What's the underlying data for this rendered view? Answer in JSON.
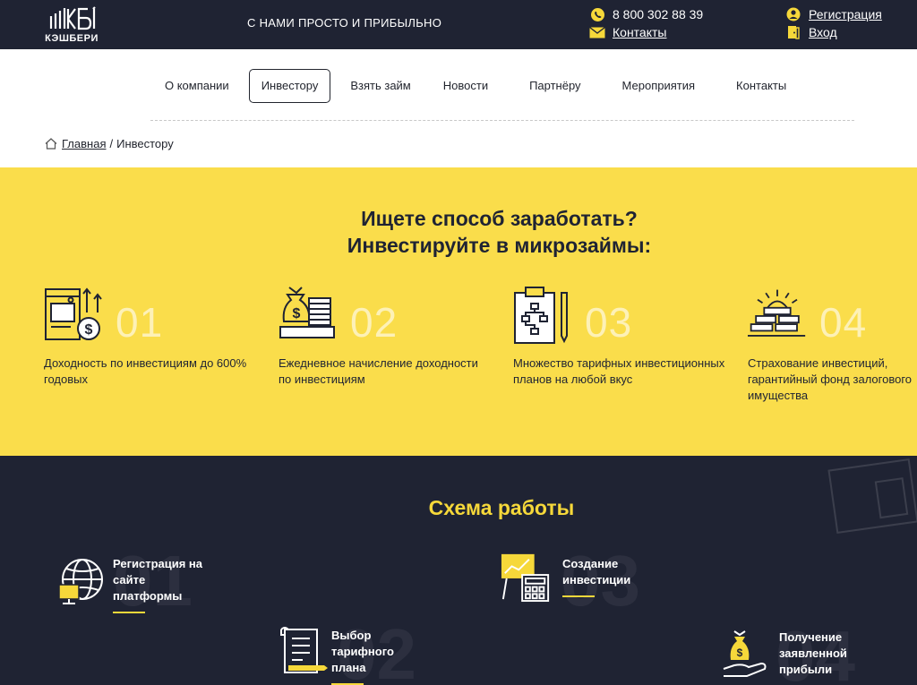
{
  "header": {
    "logo_text": "КЭШБЕРИ",
    "slogan": "С НАМИ ПРОСТО И ПРИБЫЛЬНО",
    "phone": "8 800 302 88 39",
    "contacts_label": "Контакты",
    "register_label": "Регистрация",
    "login_label": "Вход"
  },
  "nav": {
    "items": [
      {
        "label": "О компании"
      },
      {
        "label": "Инвестору"
      },
      {
        "label": "Взять займ"
      },
      {
        "label": "Новости"
      },
      {
        "label": "Партнёру"
      },
      {
        "label": "Мероприятия"
      },
      {
        "label": "Контакты"
      }
    ]
  },
  "breadcrumb": {
    "home": "Главная",
    "separator": "/",
    "current": "Инвестору"
  },
  "hero": {
    "title_line1": "Ищете способ заработать?",
    "title_line2": "Инвестируйте в микрозаймы:",
    "features": [
      {
        "num": "01",
        "text": "Доходность по инвестициям до 600% годовых",
        "icon": "cards-coin-icon"
      },
      {
        "num": "02",
        "text": "Ежедневное начисление доходности по инвестициям",
        "icon": "money-bag-coins-icon"
      },
      {
        "num": "03",
        "text": "Множество тарифных инвестиционных планов на любой вкус",
        "icon": "clipboard-chart-icon"
      },
      {
        "num": "04",
        "text": "Страхование инвестиций, гарантийный фонд залогового имущества",
        "icon": "gold-bars-icon"
      }
    ]
  },
  "scheme": {
    "title": "Схема работы",
    "steps": [
      {
        "num": "01",
        "text": "Регистрация на сайте платформы",
        "icon": "globe-monitor-icon"
      },
      {
        "num": "02",
        "text": "Выбор тарифного плана",
        "icon": "document-pen-icon"
      },
      {
        "num": "03",
        "text": "Создание инвестиции",
        "icon": "board-calculator-icon"
      },
      {
        "num": "04",
        "text": "Получение заявленной прибыли",
        "icon": "hand-money-bag-icon"
      }
    ]
  },
  "colors": {
    "dark": "#1f2333",
    "yellow": "#fadd4b",
    "accent": "#f6d83a"
  }
}
